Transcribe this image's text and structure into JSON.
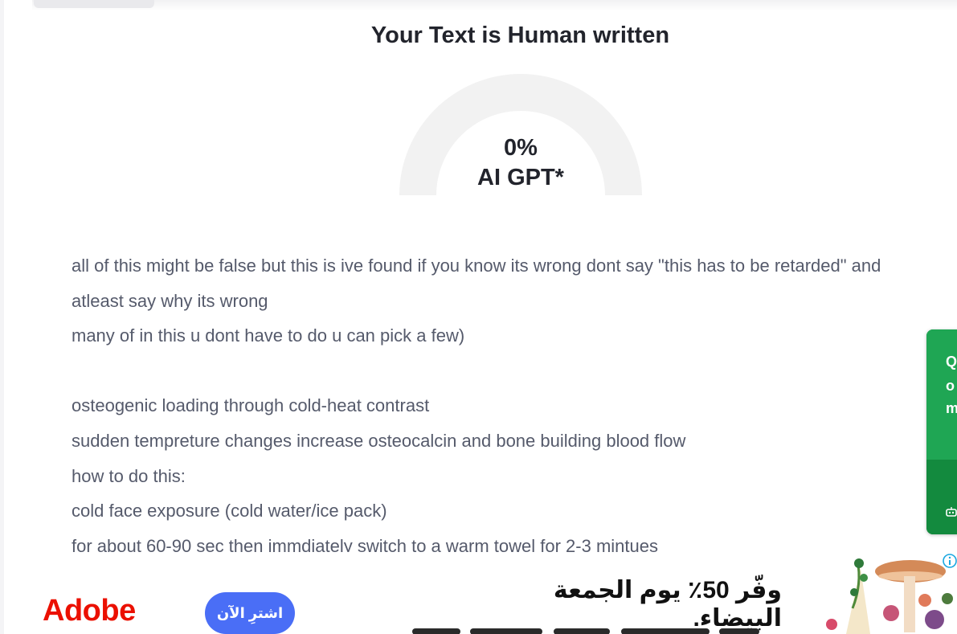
{
  "result": {
    "title": "Your Text is Human written",
    "percent_label": "0%",
    "ai_label": "AI GPT*",
    "ai_fraction": 0
  },
  "text_lines": [
    "all of this might be false but this is ive found if you know its wrong dont say \"this has to be retarded\" and",
    "atleast say why its wrong",
    "many of in this u dont have to do u can pick a few)",
    "",
    "osteogenic loading through cold-heat contrast",
    "sudden tempreture changes increase osteocalcin and bone building blood flow",
    "how to do this:",
    "cold face exposure (cold water/ice pack)",
    "for about 60-90 sec then immdiately switch to a warm towel for 2-3 mintues"
  ],
  "side_widget": {
    "letters": [
      "Q",
      "o",
      "m"
    ],
    "icon": "robot-icon"
  },
  "ad": {
    "brand": "Adobe",
    "cta": "اشترِ الآن",
    "headline": "وفّر 50٪ يوم الجمعة البيضاء.",
    "icon": "ad-info-icon"
  },
  "colors": {
    "gauge_track": "#f2f2f2",
    "title_text": "#22242c",
    "body_text": "#555a6b",
    "widget_green": "#1fa654",
    "ad_brand": "#eb1000",
    "ad_button": "#4a6ef6"
  }
}
